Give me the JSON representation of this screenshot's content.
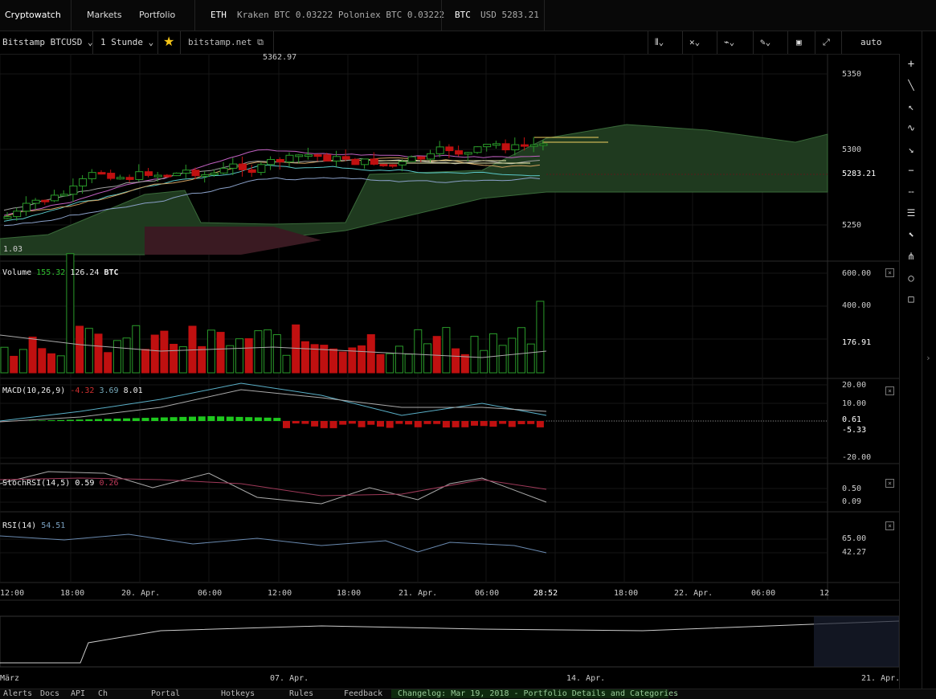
{
  "topbar": {
    "brand": "Cryptowatch",
    "markets": "Markets",
    "portfolio": "Portfolio",
    "t1_sym": "ETH",
    "t1_text": "Kraken BTC 0.03222   Poloniex BTC 0.03222",
    "t2_sym": "BTC",
    "t2_text": "USD 5283.21"
  },
  "toolbar": {
    "market": "Bitstamp BTCUSD",
    "interval": "1 Stunde",
    "star_icon": "star-icon",
    "link": "bitstamp.net",
    "auto": "auto"
  },
  "colors": {
    "up": "#2a9a2a",
    "down": "#c01010",
    "bg": "#000000",
    "grid": "#1a1a1a",
    "cloud": "#1f3a1f"
  },
  "price": {
    "high_label": "5362.97",
    "last_label": "5283.21",
    "ticks": [
      "5350",
      "5300",
      "5250"
    ],
    "left_value": "1.03"
  },
  "volume": {
    "title": "Volume",
    "v1": "155.32",
    "v2": "126.24",
    "unit": "BTC",
    "ticks": [
      "600.00",
      "400.00"
    ],
    "last": "176.91"
  },
  "macd": {
    "title": "MACD(10,26,9)",
    "v1": "-4.32",
    "v2": "3.69",
    "v3": "8.01",
    "ticks": [
      "20.00",
      "10.00",
      "-20.00"
    ],
    "last1": "0.61",
    "last2": "-5.33"
  },
  "stochrsi": {
    "title": "StochRSI(14,5)",
    "v1": "0.59",
    "v2": "0.26",
    "last1": "0.50",
    "last2": "0.09"
  },
  "rsi": {
    "title": "RSI(14)",
    "v1": "54.51",
    "tick": "65.00",
    "last": "42.27"
  },
  "xaxis": [
    "12:00",
    "18:00",
    "20. Apr.",
    "06:00",
    "12:00",
    "18:00",
    "21. Apr.",
    "06:00",
    "28:52",
    "18:00",
    "22. Apr.",
    "06:00",
    "12"
  ],
  "navigator": [
    "März",
    "07. Apr.",
    "14. Apr.",
    "21. Apr."
  ],
  "bottombar": {
    "i1": "Alerts",
    "i2": "Docs",
    "i3": "API",
    "i4": "Ch",
    "i5": "Portal",
    "i6": "Hotkeys",
    "i7": "Rules",
    "i8": "Feedback",
    "i9": "Changelog: Mar 19, 2018 - Portfolio Details and Categories"
  },
  "rightbar_icons": [
    "plus-icon",
    "line-icon",
    "arrow-line-icon",
    "curve-icon",
    "arrow-down-icon",
    "hline-icon",
    "dash-icon",
    "lines-icon",
    "cursor-icon",
    "fork-icon",
    "circle-icon",
    "square-icon"
  ]
}
